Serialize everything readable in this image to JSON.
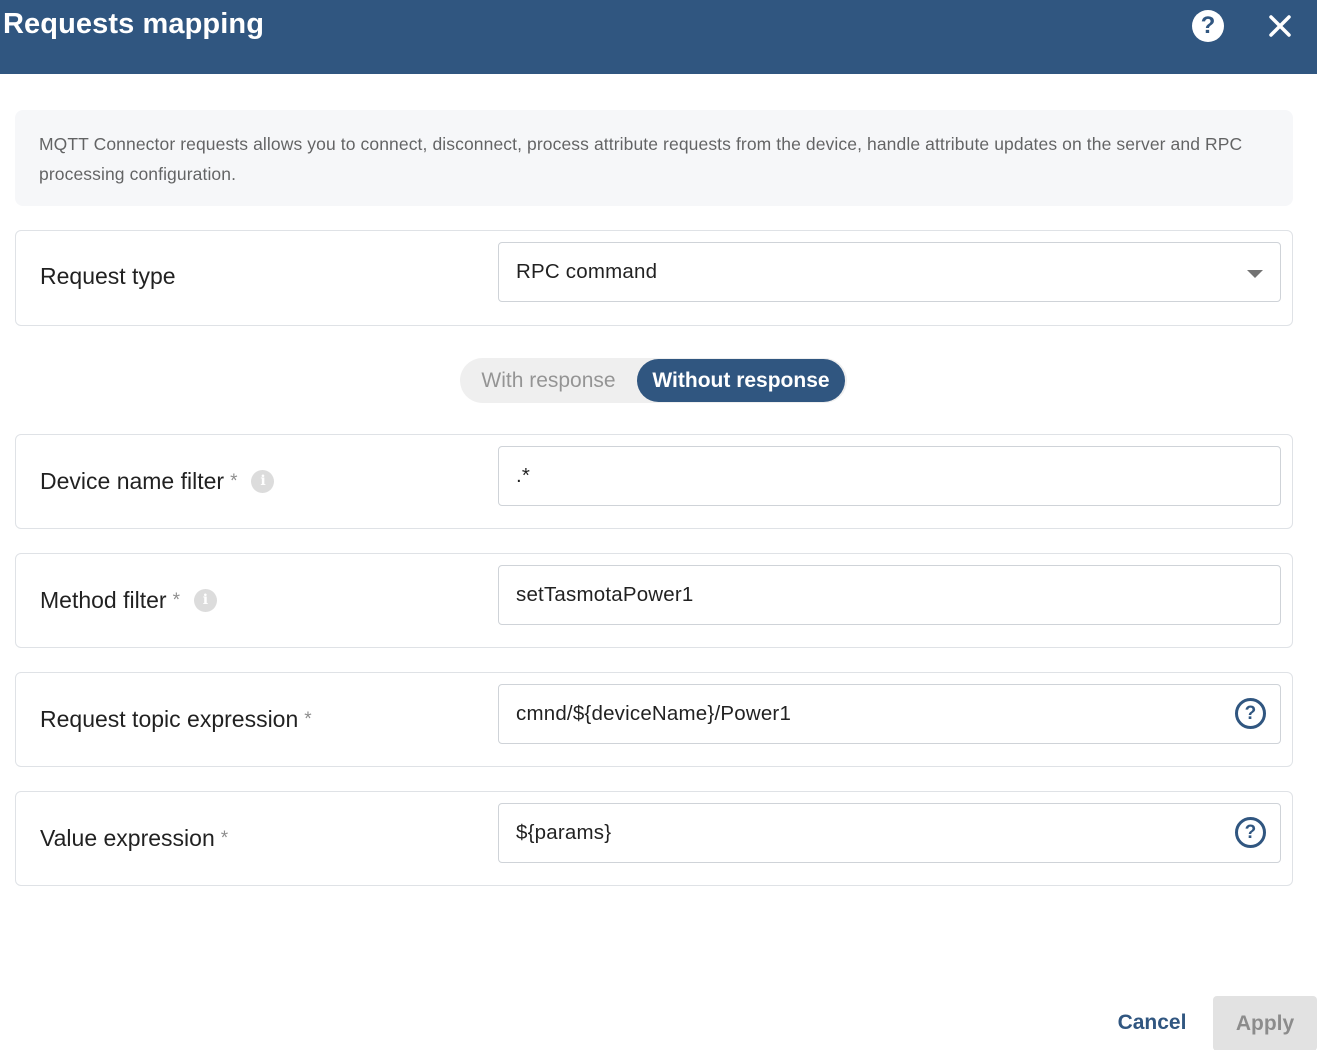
{
  "header": {
    "title": "Requests mapping",
    "help_icon": "help-circle-icon",
    "help_glyph": "?",
    "close_icon": "close-icon"
  },
  "info": {
    "text": "MQTT Connector requests allows you to connect, disconnect, process attribute requests from the device, handle attribute updates on the server and RPC processing configuration."
  },
  "request_type": {
    "label": "Request type",
    "value": "RPC command"
  },
  "response_toggle": {
    "options": [
      "With response",
      "Without response"
    ],
    "selected": "Without response"
  },
  "device_name_filter": {
    "label": "Device name filter",
    "required": "*",
    "info_glyph": "i",
    "value": ".*"
  },
  "method_filter": {
    "label": "Method filter",
    "required": "*",
    "info_glyph": "i",
    "value": "setTasmotaPower1"
  },
  "request_topic_expression": {
    "label": "Request topic expression",
    "required": "*",
    "value": "cmnd/${deviceName}/Power1",
    "help_glyph": "?"
  },
  "value_expression": {
    "label": "Value expression",
    "required": "*",
    "value": "${params}",
    "help_glyph": "?"
  },
  "footer": {
    "cancel_label": "Cancel",
    "apply_label": "Apply"
  },
  "colors": {
    "primary": "#305680",
    "banner_bg": "#f6f7f9",
    "disabled_bg": "#e2e2e2"
  }
}
